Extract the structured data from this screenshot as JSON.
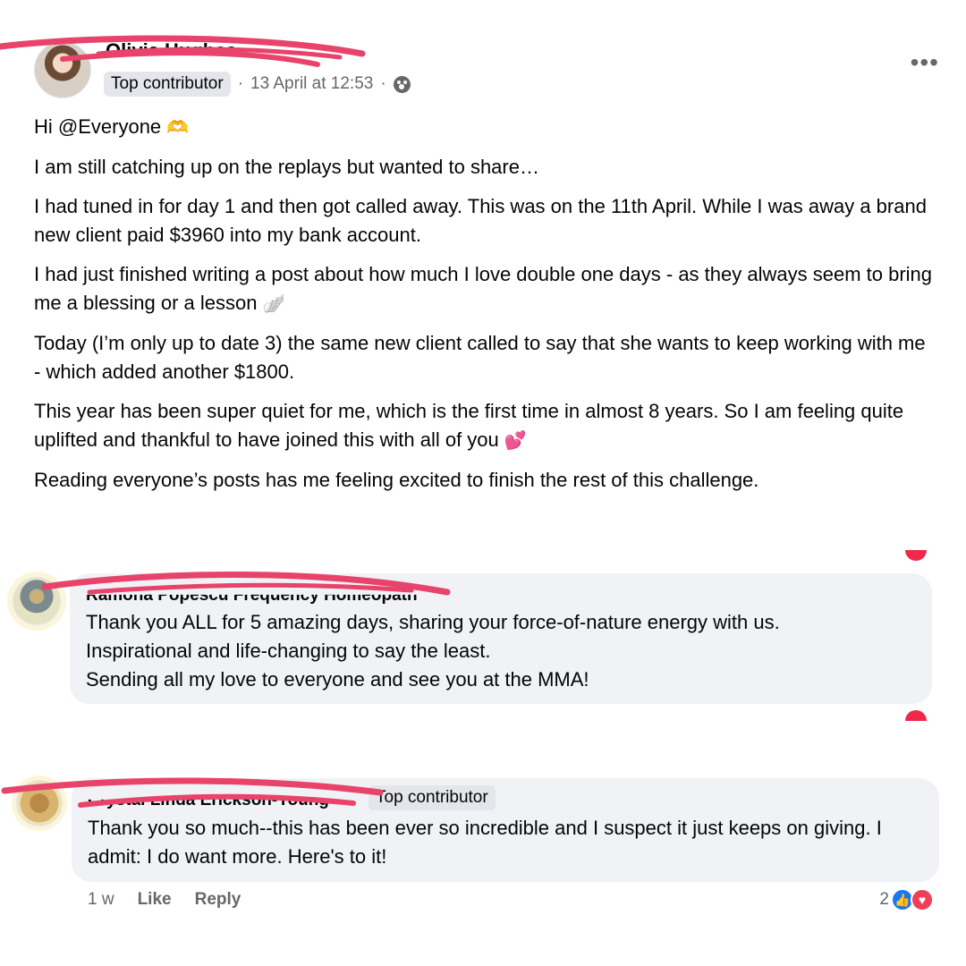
{
  "post": {
    "author": "Olivia Hughes",
    "badge": "Top contributor",
    "meta_sep": "·",
    "timestamp": "13 April at 12:53",
    "meta_sep2": "·",
    "more": "•••",
    "paragraphs": [
      "Hi @Everyone",
      "I am still catching up on the replays but wanted to share…",
      "I had tuned in for day 1 and then got called away. This was on the 11th April. While I was away a brand new client paid $3960 into my bank account.",
      "I had just finished writing a post about how much I love double one days - as they always seem to bring me a blessing or a lesson",
      "Today (I’m only up to date 3) the same new  client  called to say that she wants to keep working with me - which added another $1800.",
      "This year has been super quiet for me, which is the first time in almost 8 years. So I am feeling quite uplifted and thankful to have joined this with all of you",
      "Reading everyone’s posts has me feeling excited to finish the rest of this challenge."
    ],
    "emojis": {
      "hands": "🫶",
      "wing": "🪽",
      "hearts": "💕"
    }
  },
  "comments": [
    {
      "author": "Ramona Popescu Frequency Homeopath",
      "lines": [
        "Thank you ALL for 5 amazing days, sharing your force-of-nature energy with us.",
        "Inspirational and life-changing to say the least.",
        "Sending all my love to everyone and see you at the MMA!"
      ]
    },
    {
      "author": "Crystal Linda Erickson-Young",
      "badge": "Top contributor",
      "text": "Thank you so much--this has been ever so incredible and I suspect it just keeps on giving. I admit: I do want more. Here's to it!",
      "age": "1 w",
      "like_label": "Like",
      "reply_label": "Reply",
      "reaction_count": "2"
    }
  ],
  "colors": {
    "redaction": "#e8436a",
    "bubble": "#f0f2f5",
    "secondary_text": "#65676b",
    "like": "#1877f2",
    "love": "#f33e58"
  }
}
